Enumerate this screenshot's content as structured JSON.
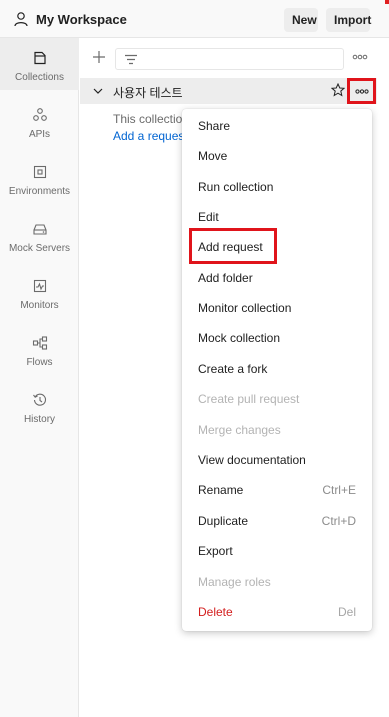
{
  "header": {
    "workspace_title": "My Workspace",
    "new_label": "New",
    "import_label": "Import"
  },
  "sidebar": {
    "items": [
      {
        "label": "Collections",
        "icon": "collections-icon",
        "active": true
      },
      {
        "label": "APIs",
        "icon": "apis-icon"
      },
      {
        "label": "Environments",
        "icon": "environments-icon"
      },
      {
        "label": "Mock Servers",
        "icon": "mock-servers-icon"
      },
      {
        "label": "Monitors",
        "icon": "monitors-icon"
      },
      {
        "label": "Flows",
        "icon": "flows-icon"
      },
      {
        "label": "History",
        "icon": "history-icon"
      }
    ]
  },
  "collection": {
    "name": "사용자 테스트",
    "empty_text": "This collection is empty",
    "add_link": "Add a request"
  },
  "menu": {
    "items": [
      {
        "label": "Share",
        "shortcut": "",
        "state": "normal"
      },
      {
        "label": "Move",
        "shortcut": "",
        "state": "normal"
      },
      {
        "label": "Run collection",
        "shortcut": "",
        "state": "normal"
      },
      {
        "label": "Edit",
        "shortcut": "",
        "state": "normal"
      },
      {
        "label": "Add request",
        "shortcut": "",
        "state": "highlighted"
      },
      {
        "label": "Add folder",
        "shortcut": "",
        "state": "normal"
      },
      {
        "label": "Monitor collection",
        "shortcut": "",
        "state": "normal"
      },
      {
        "label": "Mock collection",
        "shortcut": "",
        "state": "normal"
      },
      {
        "label": "Create a fork",
        "shortcut": "",
        "state": "normal"
      },
      {
        "label": "Create pull request",
        "shortcut": "",
        "state": "disabled"
      },
      {
        "label": "Merge changes",
        "shortcut": "",
        "state": "disabled"
      },
      {
        "label": "View documentation",
        "shortcut": "",
        "state": "normal"
      },
      {
        "label": "Rename",
        "shortcut": "Ctrl+E",
        "state": "normal"
      },
      {
        "label": "Duplicate",
        "shortcut": "Ctrl+D",
        "state": "normal"
      },
      {
        "label": "Export",
        "shortcut": "",
        "state": "normal"
      },
      {
        "label": "Manage roles",
        "shortcut": "",
        "state": "disabled"
      },
      {
        "label": "Delete",
        "shortcut": "Del",
        "state": "danger"
      }
    ]
  },
  "colors": {
    "accent_link": "#0265d2",
    "highlight_border": "#e0141b",
    "danger": "#d31e1e"
  }
}
